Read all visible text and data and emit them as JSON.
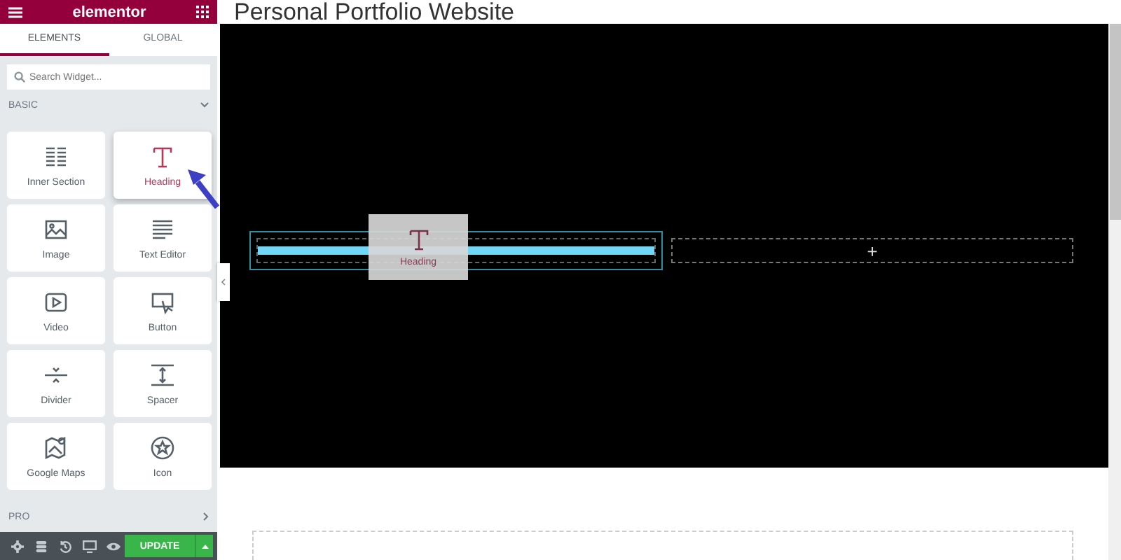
{
  "sidebar": {
    "logo": "elementor",
    "tabs": [
      {
        "label": "ELEMENTS",
        "selected": true
      },
      {
        "label": "GLOBAL",
        "selected": false
      }
    ],
    "search": {
      "placeholder": "Search Widget..."
    },
    "categories": [
      {
        "label": "BASIC",
        "expanded": true,
        "widgets": [
          {
            "label": "Inner Section",
            "kind": "section",
            "highlighted": false
          },
          {
            "label": "Heading",
            "kind": "heading",
            "highlighted": true
          },
          {
            "label": "Image",
            "kind": "image",
            "highlighted": false
          },
          {
            "label": "Text Editor",
            "kind": "text",
            "highlighted": false
          },
          {
            "label": "Video",
            "kind": "video",
            "highlighted": false
          },
          {
            "label": "Button",
            "kind": "button",
            "highlighted": false
          },
          {
            "label": "Divider",
            "kind": "divider",
            "highlighted": false
          },
          {
            "label": "Spacer",
            "kind": "spacer",
            "highlighted": false
          },
          {
            "label": "Google Maps",
            "kind": "map",
            "highlighted": false
          },
          {
            "label": "Icon",
            "kind": "icon",
            "highlighted": false
          }
        ]
      },
      {
        "label": "PRO",
        "expanded": false
      }
    ],
    "footer": {
      "update_button": "UPDATE"
    }
  },
  "canvas": {
    "page_title": "Personal Portfolio Website",
    "columns": [
      {
        "kind": "drop"
      },
      {
        "kind": "add",
        "label": "+"
      }
    ],
    "drag_preview": {
      "label": "Heading",
      "kind": "heading"
    }
  }
}
